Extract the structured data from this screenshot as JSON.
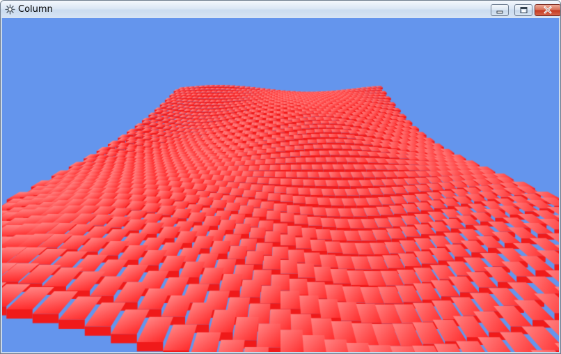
{
  "window": {
    "title": "Column",
    "controls": {
      "minimize": "minimize",
      "maximize": "maximize",
      "close": "close"
    }
  },
  "viewport": {
    "background_color": "#6495ed",
    "surface_color": "#ff2a2a",
    "surface_highlight_color": "#ff8585"
  }
}
